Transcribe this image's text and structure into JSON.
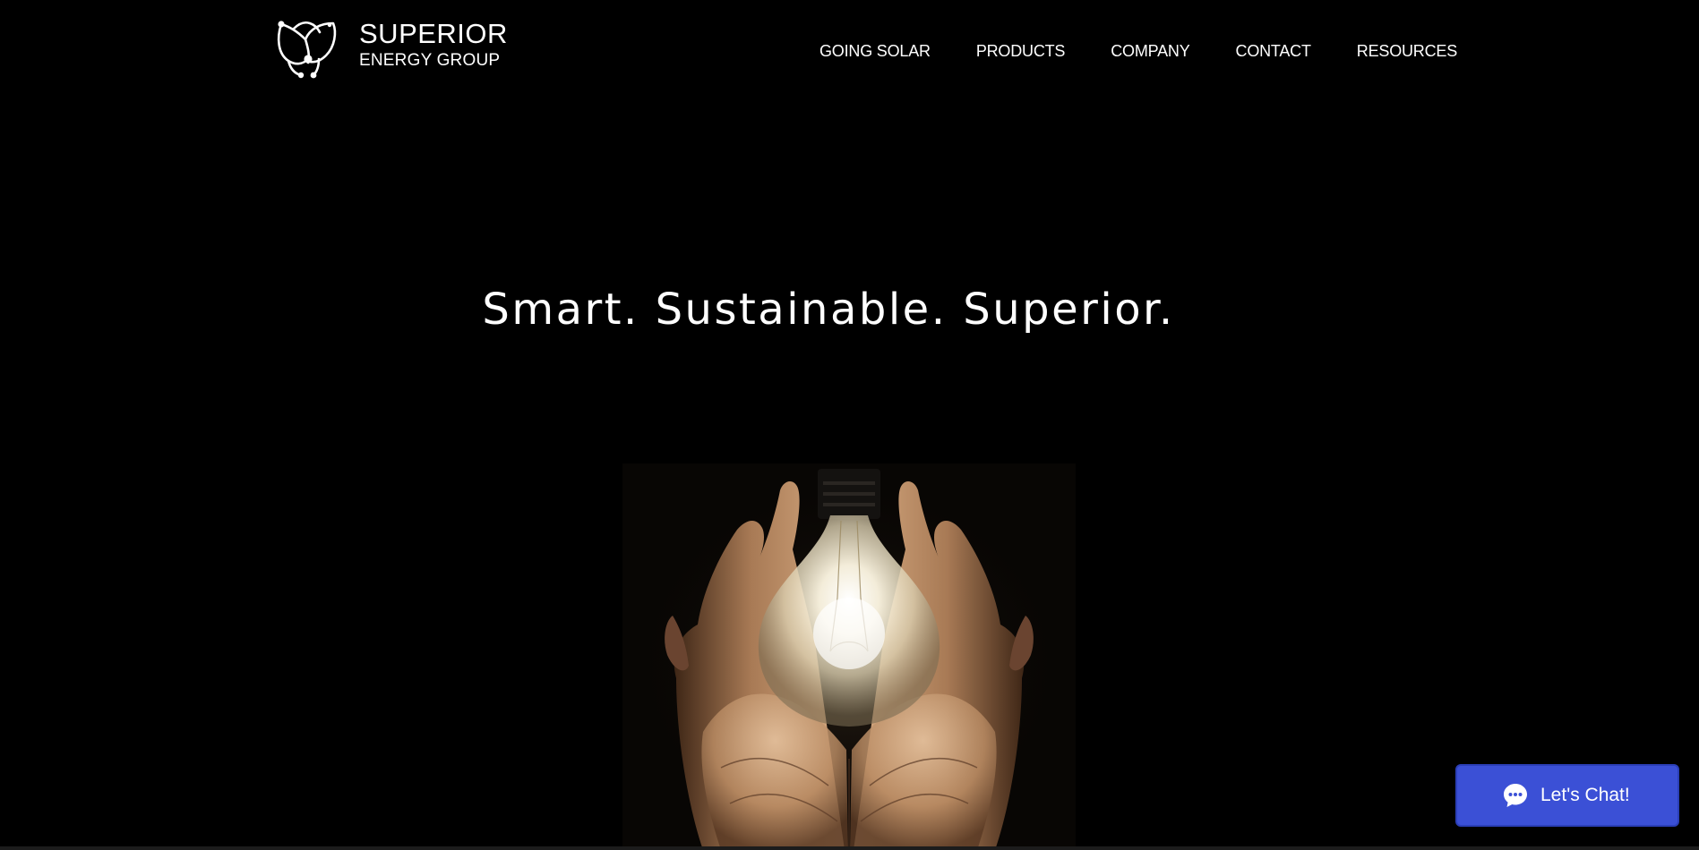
{
  "brand": {
    "name_line1": "SUPERIOR",
    "name_line2": "ENERGY GROUP",
    "logo_icon": "tulip-logo-icon"
  },
  "nav": {
    "items": [
      {
        "label": "GOING SOLAR"
      },
      {
        "label": "PRODUCTS"
      },
      {
        "label": "COMPANY"
      },
      {
        "label": "CONTACT"
      },
      {
        "label": "RESOURCES"
      }
    ]
  },
  "hero": {
    "title": "Smart. Sustainable. Superior.",
    "image": "hands-holding-lightbulb-image"
  },
  "chat": {
    "label": "Let's Chat!",
    "icon": "chat-bubble-icon",
    "color": "#3b50d6"
  },
  "colors": {
    "background": "#000000",
    "text": "#ffffff"
  }
}
